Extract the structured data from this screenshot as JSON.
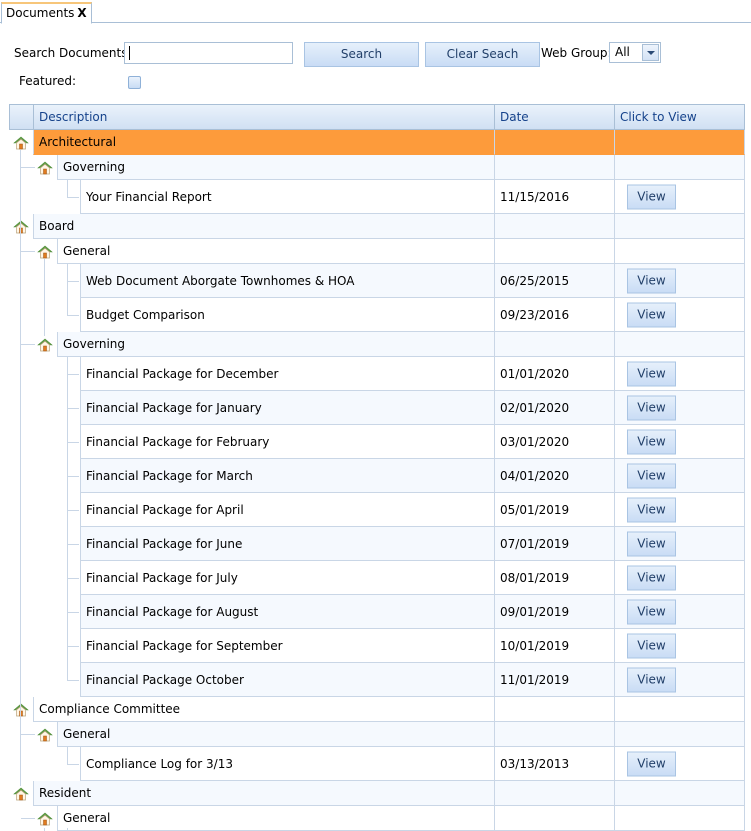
{
  "tab": {
    "label": "Documents",
    "close_label": "X"
  },
  "search": {
    "label": "Search Documents:",
    "value": "",
    "placeholder": "",
    "search_button": "Search",
    "clear_button": "Clear Seach",
    "web_group_label": "Web Group:",
    "web_group_value": "All",
    "featured_label": "Featured:",
    "featured_checked": false
  },
  "grid": {
    "columns": [
      "Description",
      "Date",
      "Click to View"
    ],
    "view_label": "View",
    "rows": [
      {
        "level": 0,
        "text": "Architectural",
        "date": "",
        "view": false,
        "style": "selected"
      },
      {
        "level": 1,
        "text": "Governing",
        "date": "",
        "view": false,
        "style": "alt"
      },
      {
        "level": 2,
        "text": "Your Financial Report",
        "date": "11/15/2016",
        "view": true,
        "style": "white"
      },
      {
        "level": 0,
        "text": "Board",
        "date": "",
        "view": false,
        "style": "alt"
      },
      {
        "level": 1,
        "text": "General",
        "date": "",
        "view": false,
        "style": "white"
      },
      {
        "level": 2,
        "text": "Web Document Aborgate Townhomes & HOA",
        "date": "06/25/2015",
        "view": true,
        "style": "alt"
      },
      {
        "level": 2,
        "text": "Budget Comparison",
        "date": "09/23/2016",
        "view": true,
        "style": "white"
      },
      {
        "level": 1,
        "text": "Governing",
        "date": "",
        "view": false,
        "style": "alt"
      },
      {
        "level": 2,
        "text": "Financial Package for December",
        "date": "01/01/2020",
        "view": true,
        "style": "white"
      },
      {
        "level": 2,
        "text": "Financial Package for January",
        "date": "02/01/2020",
        "view": true,
        "style": "alt"
      },
      {
        "level": 2,
        "text": "Financial Package for February",
        "date": "03/01/2020",
        "view": true,
        "style": "white"
      },
      {
        "level": 2,
        "text": "Financial Package for March",
        "date": "04/01/2020",
        "view": true,
        "style": "alt"
      },
      {
        "level": 2,
        "text": "Financial Package for April",
        "date": "05/01/2019",
        "view": true,
        "style": "white"
      },
      {
        "level": 2,
        "text": "Financial Package for June",
        "date": "07/01/2019",
        "view": true,
        "style": "alt"
      },
      {
        "level": 2,
        "text": "Financial Package for July",
        "date": "08/01/2019",
        "view": true,
        "style": "white"
      },
      {
        "level": 2,
        "text": "Financial Package for August",
        "date": "09/01/2019",
        "view": true,
        "style": "alt"
      },
      {
        "level": 2,
        "text": "Financial Package for September",
        "date": "10/01/2019",
        "view": true,
        "style": "white"
      },
      {
        "level": 2,
        "text": "Financial Package October",
        "date": "11/01/2019",
        "view": true,
        "style": "alt"
      },
      {
        "level": 0,
        "text": "Compliance Committee",
        "date": "",
        "view": false,
        "style": "white"
      },
      {
        "level": 1,
        "text": "General",
        "date": "",
        "view": false,
        "style": "alt"
      },
      {
        "level": 2,
        "text": "Compliance Log for 3/13",
        "date": "03/13/2013",
        "view": true,
        "style": "white"
      },
      {
        "level": 0,
        "text": "Resident",
        "date": "",
        "view": false,
        "style": "alt"
      },
      {
        "level": 1,
        "text": "General",
        "date": "",
        "view": false,
        "style": "white"
      }
    ]
  },
  "colors": {
    "selected_row": "#fd9b3b",
    "header_text": "#15428b",
    "button_text": "#213f69",
    "grid_line": "#c9d6e6",
    "alt_row": "#f5f9fe"
  }
}
